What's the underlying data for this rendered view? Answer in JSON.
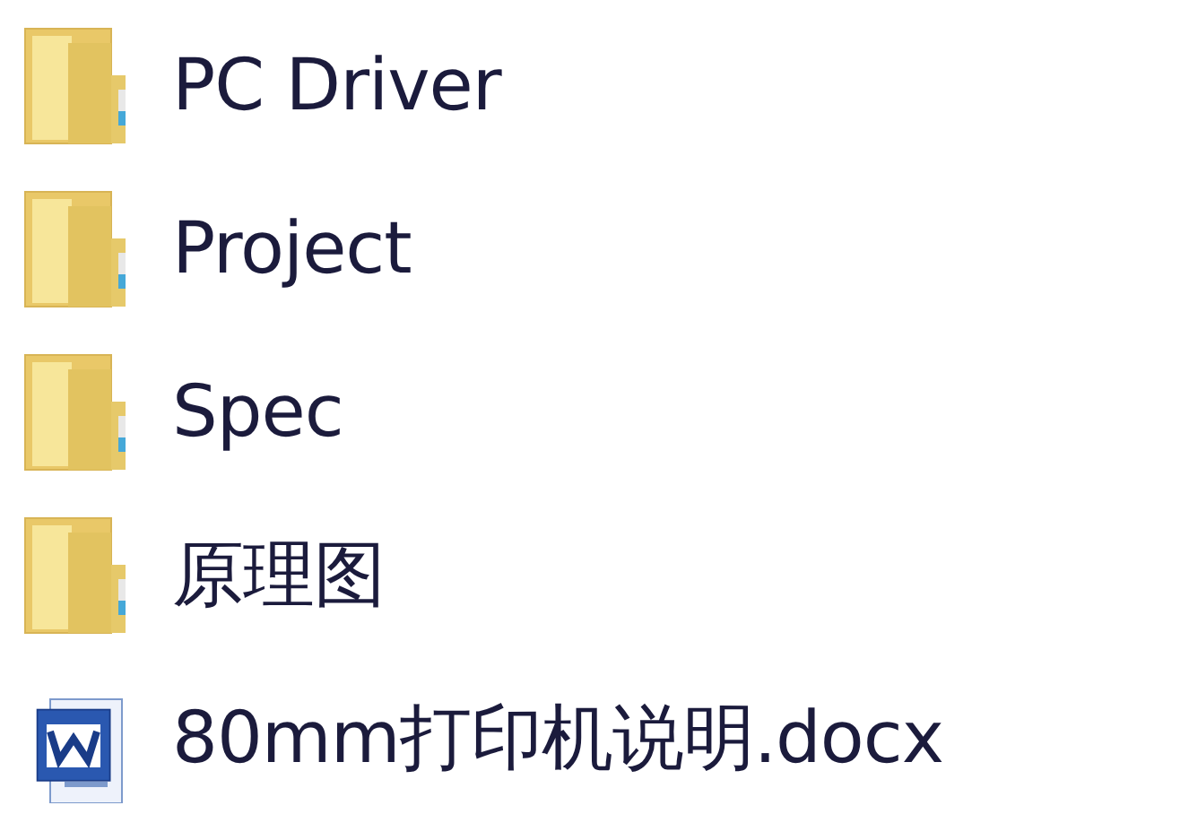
{
  "files": [
    {
      "kind": "folder",
      "name": "PC Driver"
    },
    {
      "kind": "folder",
      "name": "Project"
    },
    {
      "kind": "folder",
      "name": "Spec"
    },
    {
      "kind": "folder",
      "name": "原理图"
    },
    {
      "kind": "word",
      "name": "80mm打印机说明.docx"
    }
  ]
}
